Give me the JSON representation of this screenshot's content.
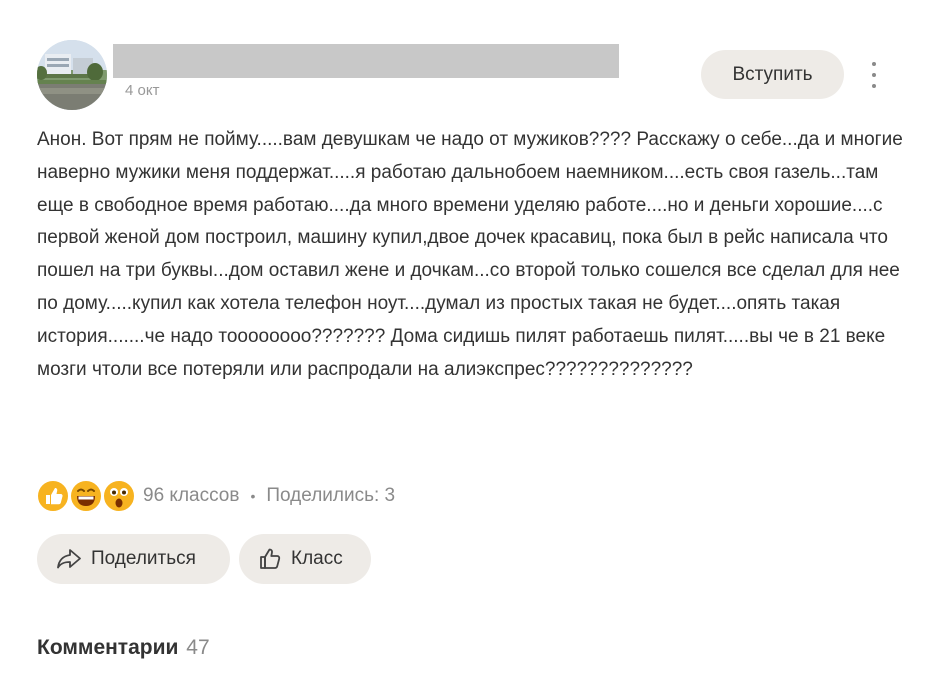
{
  "post": {
    "date": "4 окт",
    "join_label": "Вступить",
    "text": "Анон. Вот прям не пойму.....вам девушкам че надо от мужиков???? Расскажу о себе...да и многие наверно мужики меня поддержат.....я работаю дальнобоем наемником....есть своя газель...там еще в свободное время работаю....да много времени уделяю работе....но и деньги хорошие....с первой женой дом построил, машину купил,двое дочек красавиц, пока был в рейс написала что пошел на три буквы...дом оставил жене и дочкам...со второй только сошелся все сделал для нее по дому.....купил как хотела телефон ноут....думал из простых такая не будет....опять такая история.......че надо тоооооооо??????? Дома сидишь пилят работаешь пилят.....вы че в 21 веке мозги чтоли все потеряли или распродали на алиэкспрес??????????????"
  },
  "reactions": {
    "icons": [
      "thumbs-up-emoji-icon",
      "laughing-emoji-icon",
      "shocked-emoji-icon"
    ],
    "classes_text": "96 классов",
    "shared_text": "Поделились: 3"
  },
  "actions": {
    "share_label": "Поделиться",
    "like_label": "Класс"
  },
  "comments": {
    "heading": "Комментарии",
    "count": "47"
  },
  "colors": {
    "button_bg": "#eeebe7",
    "text": "#333333",
    "muted": "#8a8a8a",
    "reaction_yellow": "#f7b320",
    "redacted_bar": "#c8c8c8"
  }
}
